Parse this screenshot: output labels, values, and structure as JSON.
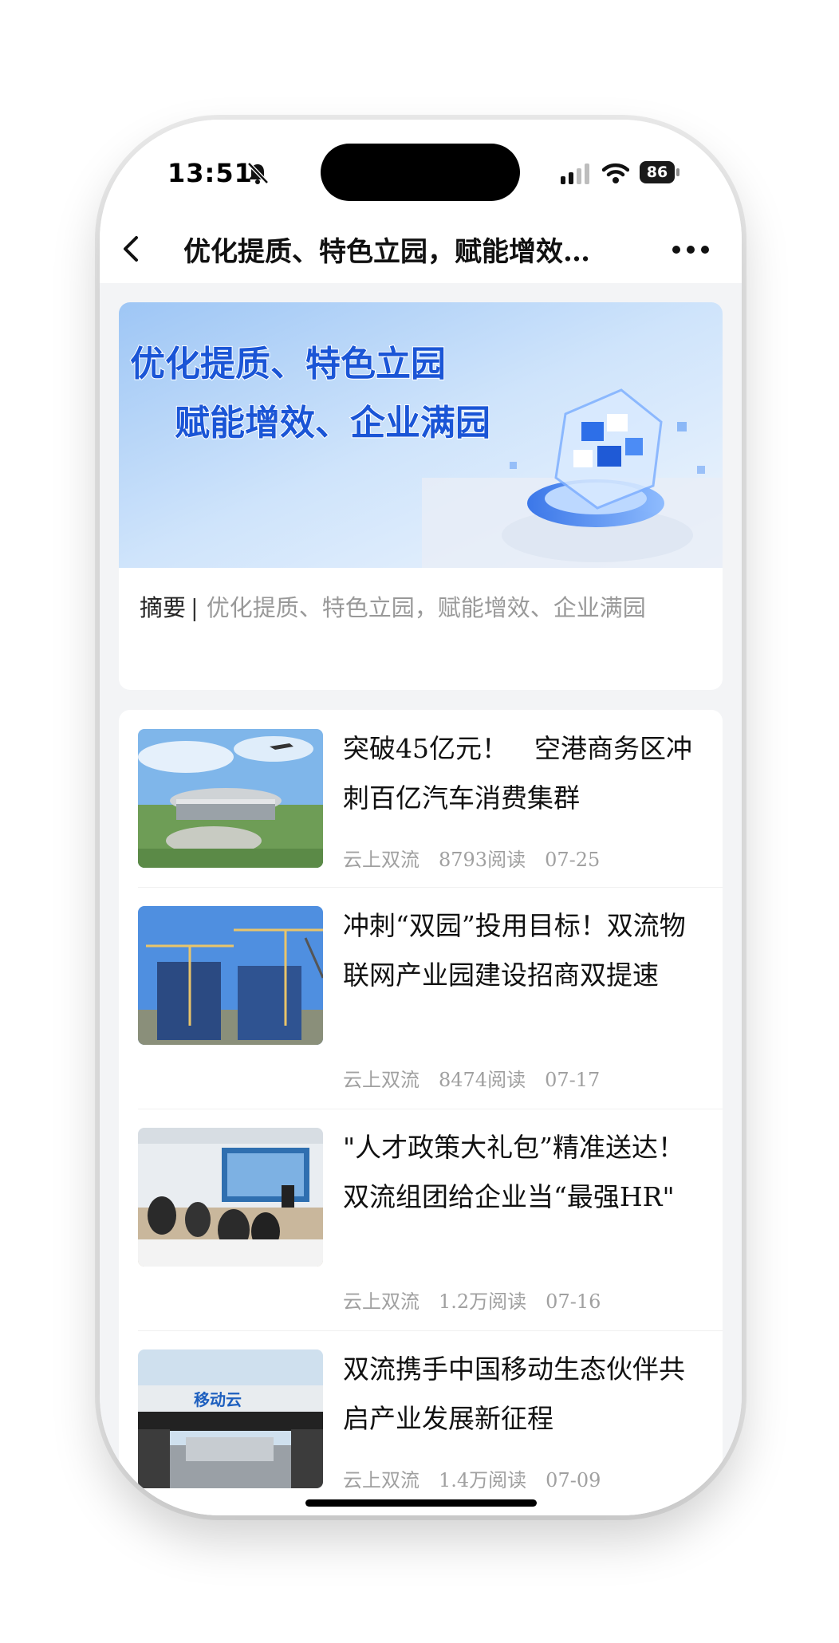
{
  "status_bar": {
    "time": "13:51",
    "battery": "86"
  },
  "nav": {
    "title": "优化提质、特色立园，赋能增效…"
  },
  "banner": {
    "line1": "优化提质、特色立园",
    "line2": "赋能增效、企业满园"
  },
  "summary": {
    "label": "摘要",
    "separator": "|",
    "text": "优化提质、特色立园，赋能增效、企业满园"
  },
  "articles": [
    {
      "title": "突破45亿元！　空港商务区冲刺百亿汽车消费集群",
      "source": "云上双流",
      "reads": "8793阅读",
      "date": "07-25"
    },
    {
      "title": "冲刺“双园”投用目标！双流物联网产业园建设招商双提速",
      "source": "云上双流",
      "reads": "8474阅读",
      "date": "07-17"
    },
    {
      "title": "\"人才政策大礼包”精准送达！双流组团给企业当“最强HR\"",
      "source": "云上双流",
      "reads": "1.2万阅读",
      "date": "07-16"
    },
    {
      "title": "双流携手中国移动生态伙伴共启产业发展新征程",
      "source": "云上双流",
      "reads": "1.4万阅读",
      "date": "07-09"
    }
  ],
  "thumb4_sign": "移动云",
  "colors": {
    "accent": "#2f6fe0",
    "background": "#f3f4f6",
    "meta_text": "#a0a0a0"
  }
}
